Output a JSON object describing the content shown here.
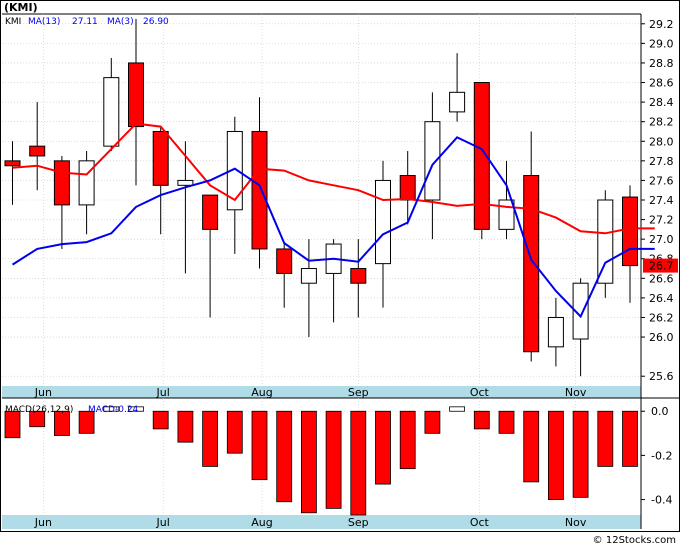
{
  "header": {
    "title": "(KMI)",
    "watermark": "© 12Stocks.com"
  },
  "colors": {
    "up_candle": "#ffffff",
    "down_candle": "#ff0000",
    "wick": "#000000",
    "ma_long": "#ff0000",
    "ma_short": "#0000ee",
    "axis_band": "#b0dce8",
    "grid": "#c8c8c8",
    "price_badge": "#ff0000",
    "macd_neg": "#ff0000",
    "macd_pos": "#ffffff"
  },
  "chart_data": [
    {
      "type": "candlestick",
      "name": "price",
      "legend": [
        {
          "label": "KMI",
          "value": ""
        },
        {
          "label": "MA(13)",
          "value": "27.11"
        },
        {
          "label": "MA(3)",
          "value": "26.90"
        }
      ],
      "current_price_label": "26.7",
      "ylim": [
        25.5,
        29.3
      ],
      "y_ticks": [
        25.6,
        26.0,
        26.2,
        26.4,
        26.6,
        26.8,
        27.0,
        27.2,
        27.4,
        27.6,
        27.8,
        28.0,
        28.2,
        28.4,
        28.6,
        28.8,
        29.0,
        29.2
      ],
      "y_tick_labels": [
        "25.6",
        "26.0",
        "26.2",
        "26.4",
        "26.6",
        "26.8",
        "27.0",
        "27.2",
        "27.4",
        "27.6",
        "27.8",
        "28.0",
        "28.2",
        "28.4",
        "28.6",
        "28.8",
        "29.0",
        "29.2"
      ],
      "x_labels": [
        "Jun",
        "Jul",
        "Aug",
        "Sep",
        "Oct",
        "Nov"
      ],
      "x_label_positions": [
        1.25,
        6.1,
        10.1,
        14.0,
        18.9,
        22.8
      ],
      "candles": [
        {
          "o": 27.8,
          "h": 28.0,
          "l": 27.35,
          "c": 27.75
        },
        {
          "o": 27.95,
          "h": 28.4,
          "l": 27.5,
          "c": 27.85
        },
        {
          "o": 27.8,
          "h": 27.85,
          "l": 26.9,
          "c": 27.35
        },
        {
          "o": 27.35,
          "h": 27.9,
          "l": 27.05,
          "c": 27.8
        },
        {
          "o": 27.95,
          "h": 28.85,
          "l": 27.9,
          "c": 28.65
        },
        {
          "o": 28.8,
          "h": 29.25,
          "l": 27.55,
          "c": 28.15
        },
        {
          "o": 28.1,
          "h": 28.15,
          "l": 27.05,
          "c": 27.55
        },
        {
          "o": 27.55,
          "h": 28.0,
          "l": 26.65,
          "c": 27.6
        },
        {
          "o": 27.45,
          "h": 27.45,
          "l": 26.2,
          "c": 27.1
        },
        {
          "o": 27.3,
          "h": 28.25,
          "l": 26.85,
          "c": 28.1
        },
        {
          "o": 28.1,
          "h": 28.45,
          "l": 26.7,
          "c": 26.9
        },
        {
          "o": 26.9,
          "h": 26.95,
          "l": 26.3,
          "c": 26.65
        },
        {
          "o": 26.55,
          "h": 27.0,
          "l": 26.0,
          "c": 26.7
        },
        {
          "o": 26.65,
          "h": 27.0,
          "l": 26.15,
          "c": 26.95
        },
        {
          "o": 26.7,
          "h": 27.0,
          "l": 26.2,
          "c": 26.55
        },
        {
          "o": 26.75,
          "h": 27.8,
          "l": 26.3,
          "c": 27.6
        },
        {
          "o": 27.65,
          "h": 27.9,
          "l": 27.15,
          "c": 27.4
        },
        {
          "o": 27.4,
          "h": 28.5,
          "l": 27.0,
          "c": 28.2
        },
        {
          "o": 28.3,
          "h": 28.9,
          "l": 28.2,
          "c": 28.5
        },
        {
          "o": 28.6,
          "h": 28.6,
          "l": 27.0,
          "c": 27.1
        },
        {
          "o": 27.1,
          "h": 27.8,
          "l": 27.0,
          "c": 27.4
        },
        {
          "o": 27.65,
          "h": 28.1,
          "l": 25.75,
          "c": 25.85
        },
        {
          "o": 25.9,
          "h": 26.4,
          "l": 25.7,
          "c": 26.2
        },
        {
          "o": 25.98,
          "h": 26.6,
          "l": 25.6,
          "c": 26.55
        },
        {
          "o": 26.55,
          "h": 27.5,
          "l": 26.4,
          "c": 27.4
        },
        {
          "o": 27.43,
          "h": 27.55,
          "l": 26.35,
          "c": 26.73
        }
      ],
      "series": [
        {
          "name": "MA(13)",
          "values": [
            27.73,
            27.75,
            27.68,
            27.66,
            27.92,
            28.18,
            28.15,
            27.85,
            27.55,
            27.4,
            27.72,
            27.7,
            27.6,
            27.55,
            27.5,
            27.4,
            27.41,
            27.38,
            27.34,
            27.36,
            27.33,
            27.31,
            27.22,
            27.08,
            27.06,
            27.11,
            27.11
          ]
        },
        {
          "name": "MA(3)",
          "values": [
            26.74,
            26.9,
            26.95,
            26.97,
            27.06,
            27.33,
            27.45,
            27.53,
            27.6,
            27.72,
            27.55,
            26.96,
            26.78,
            26.8,
            26.77,
            27.05,
            27.17,
            27.76,
            28.04,
            27.92,
            27.55,
            26.79,
            26.47,
            26.21,
            26.76,
            26.9,
            26.9
          ]
        }
      ]
    },
    {
      "type": "bar",
      "name": "macd",
      "legend": [
        {
          "label": "MACD(26,12,9)",
          "value": ""
        },
        {
          "label": "MACD:",
          "value": "-0.24"
        }
      ],
      "ylim": [
        -0.47,
        0.06
      ],
      "y_ticks": [
        0.0,
        -0.2,
        -0.4
      ],
      "y_tick_labels": [
        "0.0",
        "-0.2",
        "-0.4"
      ],
      "x_labels": [
        "Jun",
        "Jul",
        "Aug",
        "Sep",
        "Oct",
        "Nov"
      ],
      "values": [
        -0.12,
        -0.07,
        -0.11,
        -0.1,
        0.02,
        0.02,
        -0.08,
        -0.14,
        -0.25,
        -0.19,
        -0.31,
        -0.41,
        -0.46,
        -0.44,
        -0.47,
        -0.33,
        -0.26,
        -0.1,
        0.02,
        -0.08,
        -0.1,
        -0.32,
        -0.4,
        -0.39,
        -0.25,
        -0.25
      ]
    }
  ]
}
